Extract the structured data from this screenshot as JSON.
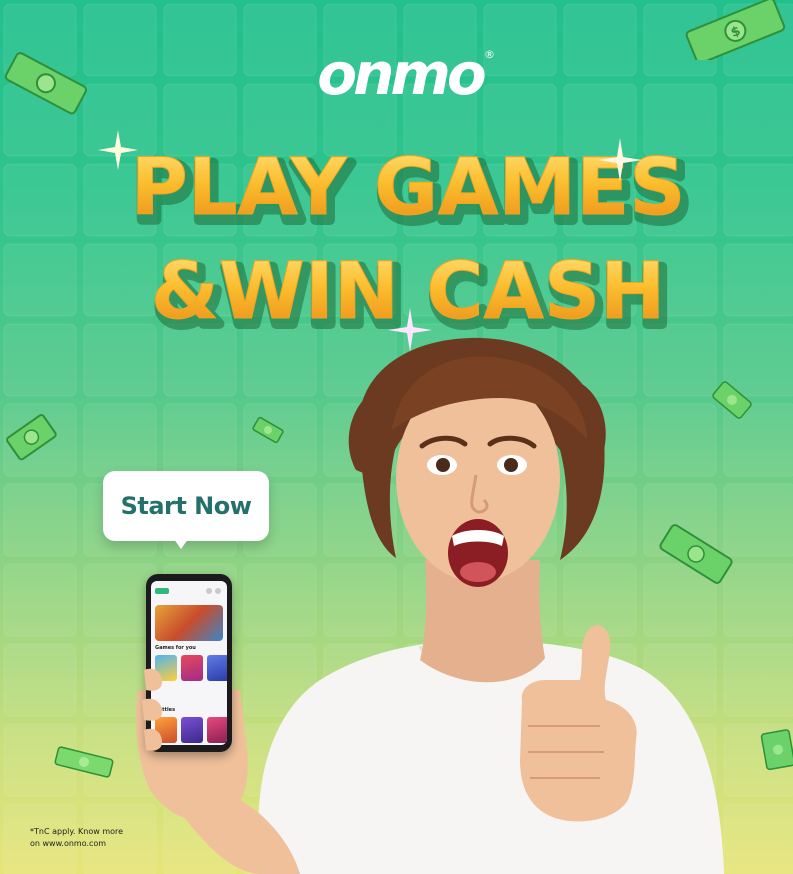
{
  "brand": {
    "logo_text": "onmo",
    "registered_mark": "®"
  },
  "headline": {
    "line1": "PLAY GAMES",
    "line2": "&WIN CASH"
  },
  "cta": {
    "label": "Start Now"
  },
  "phone": {
    "section_games": "Games for you",
    "section_battles": "Battles"
  },
  "disclaimer": {
    "line1": "*TnC apply. Know more",
    "line2": "on www.onmo.com"
  },
  "colors": {
    "background_top": "#22c08d",
    "background_bottom": "#e7e57a",
    "headline_gold": "#f7b82e",
    "cta_text": "#25706b",
    "money_green": "#6bd26a"
  },
  "icons": [
    "money-bill-icon",
    "sparkle-icon"
  ]
}
